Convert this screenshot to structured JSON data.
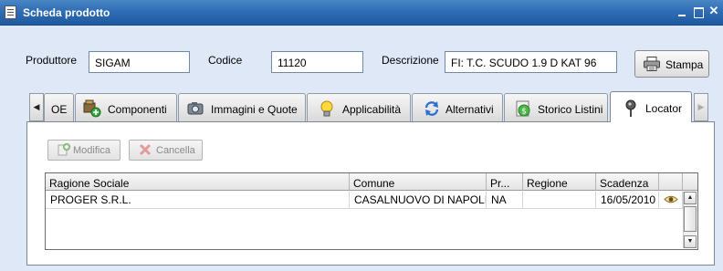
{
  "window": {
    "title": "Scheda prodotto",
    "minimize_label": "_",
    "maximize_label": "□",
    "close_label": "✕"
  },
  "fields": {
    "produttore_label": "Produttore",
    "produttore_value": "SIGAM",
    "codice_label": "Codice",
    "codice_value": "11120",
    "descrizione_label": "Descrizione",
    "descrizione_value": "FI: T.C. SCUDO 1.9 D KAT 96"
  },
  "toolbar": {
    "stampa_label": "Stampa"
  },
  "tabs": [
    {
      "label": "OE",
      "icon": "none"
    },
    {
      "label": "Componenti",
      "icon": "components-icon"
    },
    {
      "label": "Immagini e Quote",
      "icon": "camera-icon"
    },
    {
      "label": "Applicabilità",
      "icon": "lightbulb-icon"
    },
    {
      "label": "Alternativi",
      "icon": "refresh-arrows-icon"
    },
    {
      "label": "Storico Listini",
      "icon": "price-list-icon"
    },
    {
      "label": "Locator",
      "icon": "map-pin-icon",
      "active": true
    }
  ],
  "tab_scroll": {
    "left": "◀",
    "right": "▶"
  },
  "panel": {
    "modifica_label": "Modifica",
    "cancella_label": "Cancella"
  },
  "grid": {
    "columns": [
      "Ragione Sociale",
      "Comune",
      "Pr...",
      "Regione",
      "Scadenza"
    ],
    "rows": [
      [
        "PROGER S.R.L.",
        "CASALNUOVO DI NAPOLI",
        "NA",
        "",
        "16/05/2010"
      ]
    ],
    "scroll_up": "▲",
    "scroll_down": "▼"
  },
  "colors": {
    "titlebar": "#2f6db4",
    "background": "#dfe8f6",
    "border": "#6e8aa8"
  }
}
